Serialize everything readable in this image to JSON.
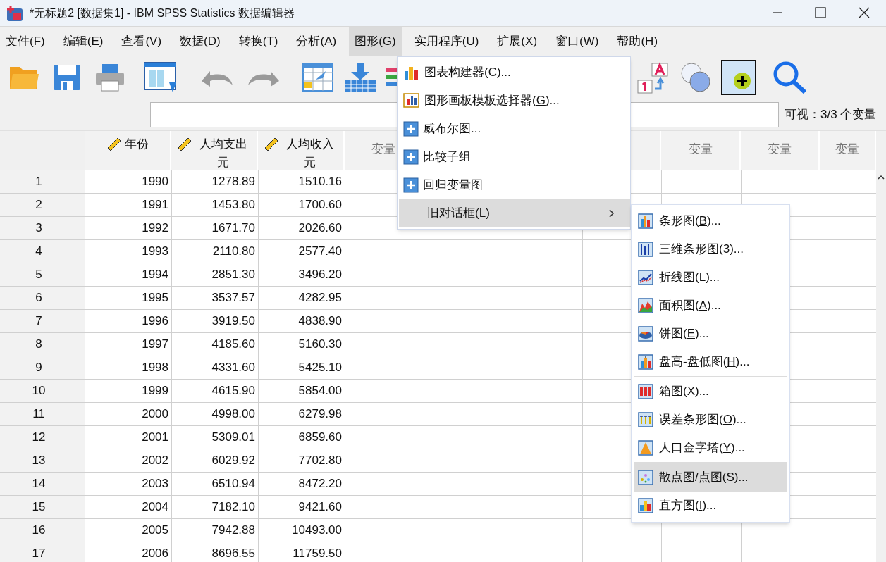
{
  "window": {
    "title": "*无标题2 [数据集1] - IBM SPSS Statistics 数据编辑器"
  },
  "menu_bar": [
    {
      "label": "文件(",
      "key": "F",
      "tail": ")",
      "selected": false
    },
    {
      "label": "编辑(",
      "key": "E",
      "tail": ")",
      "selected": false
    },
    {
      "label": "查看(",
      "key": "V",
      "tail": ")",
      "selected": false
    },
    {
      "label": "数据(",
      "key": "D",
      "tail": ")",
      "selected": false
    },
    {
      "label": "转换(",
      "key": "T",
      "tail": ")",
      "selected": false
    },
    {
      "label": "分析(",
      "key": "A",
      "tail": ")",
      "selected": false
    },
    {
      "label": "图形(",
      "key": "G",
      "tail": ")",
      "selected": true
    },
    {
      "label": "实用程序(",
      "key": "U",
      "tail": ")",
      "selected": false
    },
    {
      "label": "扩展(",
      "key": "X",
      "tail": ")",
      "selected": false
    },
    {
      "label": "窗口(",
      "key": "W",
      "tail": ")",
      "selected": false
    },
    {
      "label": "帮助(",
      "key": "H",
      "tail": ")",
      "selected": false
    }
  ],
  "status": {
    "visible_vars": "可视：3/3 个变量"
  },
  "table": {
    "columns": [
      {
        "label": "年份"
      },
      {
        "label": "人均支出元"
      },
      {
        "label": "人均收入元"
      }
    ],
    "empty_columns": [
      {
        "label": "变量"
      },
      {},
      {},
      {},
      {
        "label": "变量"
      },
      {
        "label": "变量"
      },
      {
        "label": "变量"
      }
    ],
    "rows": [
      {
        "number": "1",
        "cells": [
          "1990",
          "1278.89",
          "1510.16"
        ]
      },
      {
        "number": "2",
        "cells": [
          "1991",
          "1453.80",
          "1700.60"
        ]
      },
      {
        "number": "3",
        "cells": [
          "1992",
          "1671.70",
          "2026.60"
        ]
      },
      {
        "number": "4",
        "cells": [
          "1993",
          "2110.80",
          "2577.40"
        ]
      },
      {
        "number": "5",
        "cells": [
          "1994",
          "2851.30",
          "3496.20"
        ]
      },
      {
        "number": "6",
        "cells": [
          "1995",
          "3537.57",
          "4282.95"
        ]
      },
      {
        "number": "7",
        "cells": [
          "1996",
          "3919.50",
          "4838.90"
        ]
      },
      {
        "number": "8",
        "cells": [
          "1997",
          "4185.60",
          "5160.30"
        ]
      },
      {
        "number": "9",
        "cells": [
          "1998",
          "4331.60",
          "5425.10"
        ]
      },
      {
        "number": "10",
        "cells": [
          "1999",
          "4615.90",
          "5854.00"
        ]
      },
      {
        "number": "11",
        "cells": [
          "2000",
          "4998.00",
          "6279.98"
        ]
      },
      {
        "number": "12",
        "cells": [
          "2001",
          "5309.01",
          "6859.60"
        ]
      },
      {
        "number": "13",
        "cells": [
          "2002",
          "6029.92",
          "7702.80"
        ]
      },
      {
        "number": "14",
        "cells": [
          "2003",
          "6510.94",
          "8472.20"
        ]
      },
      {
        "number": "15",
        "cells": [
          "2004",
          "7182.10",
          "9421.60"
        ]
      },
      {
        "number": "16",
        "cells": [
          "2005",
          "7942.88",
          "10493.00"
        ]
      },
      {
        "number": "17",
        "cells": [
          "2006",
          "8696.55",
          "11759.50"
        ]
      }
    ]
  },
  "graph_menu": [
    {
      "label": "图表构建器(",
      "key": "C",
      "tail": ")...",
      "selected": false,
      "kind": "item"
    },
    {
      "label": "图形画板模板选择器(",
      "key": "G",
      "tail": ")...",
      "selected": false,
      "kind": "item"
    },
    {
      "label": "威布尔图...",
      "selected": false,
      "kind": "item"
    },
    {
      "label": "比较子组",
      "selected": false,
      "kind": "item"
    },
    {
      "label": "回归变量图",
      "selected": false,
      "kind": "item"
    },
    {
      "label": "旧对话框(",
      "key": "L",
      "tail": ")",
      "selected": true,
      "kind": "submenu"
    }
  ],
  "legacy_menu": [
    {
      "label": "条形图(",
      "key": "B",
      "tail": ")...",
      "selected": false
    },
    {
      "label": "三维条形图(",
      "key": "3",
      "tail": ")...",
      "selected": false
    },
    {
      "label": "折线图(",
      "key": "L",
      "tail": ")...",
      "selected": false
    },
    {
      "label": "面积图(",
      "key": "A",
      "tail": ")...",
      "selected": false
    },
    {
      "label": "饼图(",
      "key": "E",
      "tail": ")...",
      "selected": false
    },
    {
      "label": "盘高-盘低图(",
      "key": "H",
      "tail": ")...",
      "selected": false
    },
    {
      "label": "箱图(",
      "key": "X",
      "tail": ")...",
      "selected": false
    },
    {
      "label": "误差条形图(",
      "key": "O",
      "tail": ")...",
      "selected": false
    },
    {
      "label": "人口金字塔(",
      "key": "Y",
      "tail": ")...",
      "selected": false
    },
    {
      "label": "散点图/点图(",
      "key": "S",
      "tail": ")...",
      "selected": true
    },
    {
      "label": "直方图(",
      "key": "I",
      "tail": ")...",
      "selected": false
    }
  ]
}
